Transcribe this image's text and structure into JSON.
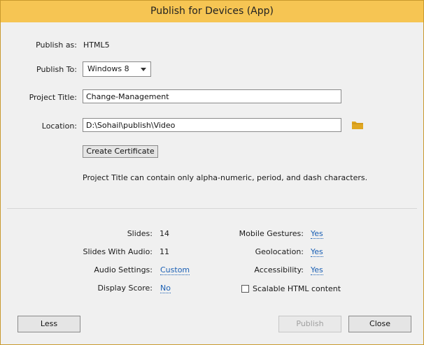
{
  "window": {
    "title": "Publish for Devices (App)"
  },
  "fields": {
    "publish_as_label": "Publish as:",
    "publish_as_value": "HTML5",
    "publish_to_label": "Publish To:",
    "publish_to_value": "Windows 8",
    "project_title_label": "Project Title:",
    "project_title_value": "Change-Management",
    "location_label": "Location:",
    "location_value": "D:\\Sohail\\publish\\Video",
    "create_certificate_label": "Create Certificate",
    "hint": "Project Title can contain only alpha-numeric, period, and dash characters."
  },
  "summary": {
    "left": [
      {
        "label": "Slides:",
        "value": "14",
        "link": false
      },
      {
        "label": "Slides With Audio:",
        "value": "11",
        "link": false
      },
      {
        "label": "Audio Settings:",
        "value": "Custom",
        "link": true
      },
      {
        "label": "Display Score:",
        "value": "No",
        "link": true
      }
    ],
    "right": [
      {
        "label": "Mobile Gestures:",
        "value": "Yes"
      },
      {
        "label": "Geolocation:",
        "value": "Yes"
      },
      {
        "label": "Accessibility:",
        "value": "Yes"
      }
    ],
    "scalable_label": "Scalable HTML content",
    "scalable_checked": false
  },
  "buttons": {
    "less": "Less",
    "publish": "Publish",
    "close": "Close"
  },
  "colors": {
    "titlebar": "#f6c553",
    "link": "#1a5fb4",
    "folder": "#e0a722"
  },
  "icons": {
    "folder": "folder-icon",
    "dropdown": "chevron-down-icon"
  }
}
